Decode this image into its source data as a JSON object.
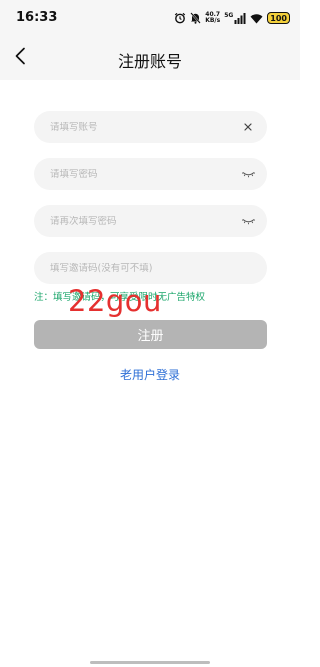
{
  "status_bar": {
    "time": "16:33",
    "network_speed_value": "40.7",
    "network_speed_unit": "KB/s",
    "signal_label": "5G",
    "battery": "100",
    "icons": [
      "alarm-icon",
      "mute-icon",
      "signal-icon",
      "wifi-icon",
      "battery-icon"
    ]
  },
  "header": {
    "title": "注册账号",
    "back_icon": "chevron-left-icon"
  },
  "form": {
    "account_placeholder": "请填写账号",
    "password_placeholder": "请填写密码",
    "confirm_password_placeholder": "请再次填写密码",
    "invite_placeholder": "填写邀请码(没有可不填)"
  },
  "note": "注：填写邀请码，可享受限时无广告特权",
  "watermark": "22gou",
  "register_button": "注册",
  "login_link": "老用户登录",
  "colors": {
    "accent_link": "#2e6fd6",
    "note_green": "#1aa56a",
    "button_disabled": "#b4b4b4",
    "field_bg": "#f4f4f4",
    "watermark_red": "#e5302f",
    "battery_yellow": "#f3d03b"
  }
}
